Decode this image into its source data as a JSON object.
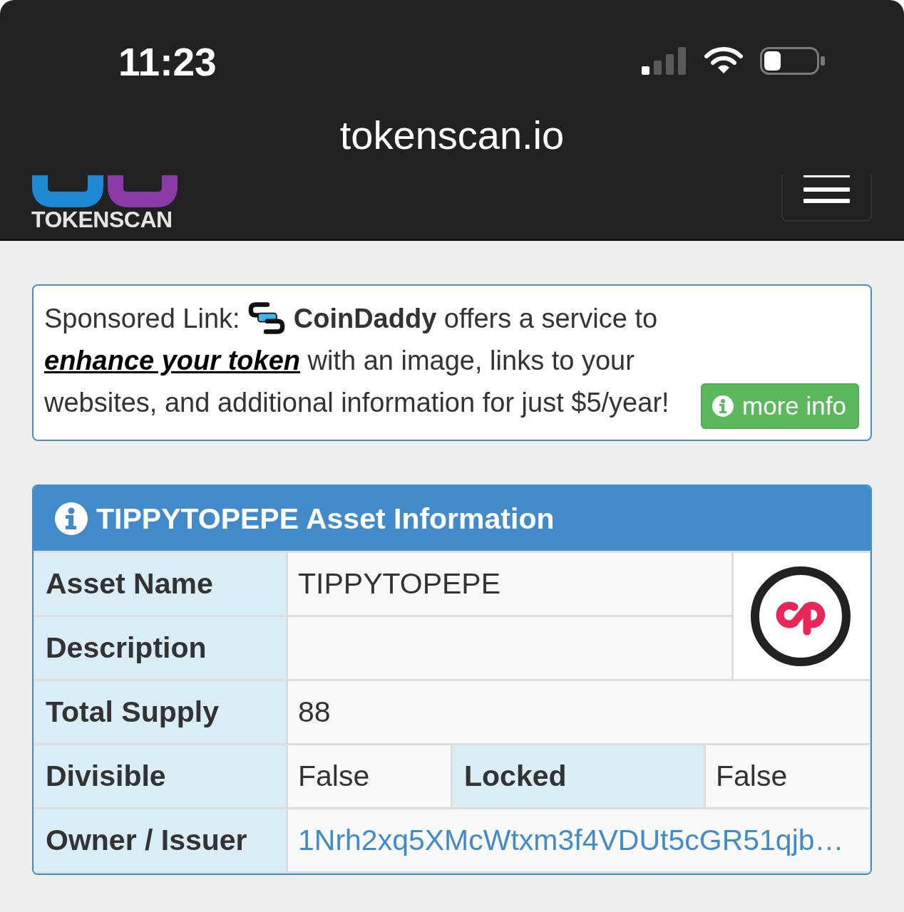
{
  "status_bar": {
    "time": "11:23"
  },
  "browser": {
    "url": "tokenscan.io"
  },
  "navbar": {
    "logo_text": "TOKENSCAN"
  },
  "sponsored": {
    "prefix": "Sponsored Link:",
    "body": "**CoinDaddy** offers a service to",
    "link": "enhance your token",
    "suffix": "with an image, links to your websites, and additional information for just $5/year!",
    "button": "more info"
  },
  "asset_panel": {
    "title": "TIPPYTOPEPE Asset Information",
    "rows": [
      {
        "kind": "text",
        "label": "Asset Name",
        "value": "TIPPYTOPEPE"
      },
      {
        "kind": "text",
        "label": "Description"
      },
      {
        "kind": "text",
        "label": "Total Supply",
        "value": "88"
      },
      {
        "kind": "pair",
        "label": "Divisible",
        "value": "False",
        "label_2": "Locked",
        "value_2": "False"
      },
      {
        "kind": "link",
        "label": "Owner / Issuer",
        "value": "1Nrh2xq5XMcWtxm3f4VDUt5cGR51qjb…"
      }
    ]
  }
}
